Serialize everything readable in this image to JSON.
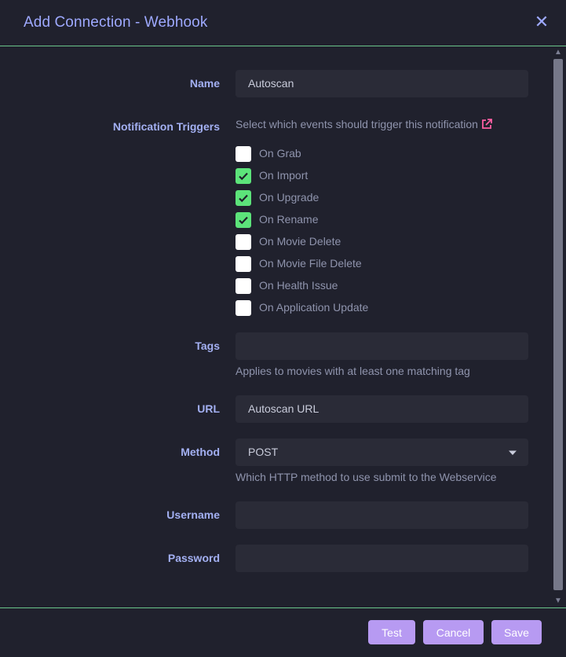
{
  "header": {
    "title": "Add Connection - Webhook",
    "close_glyph": "✕"
  },
  "fields": {
    "name": {
      "label": "Name",
      "value": "Autoscan"
    },
    "triggers": {
      "label": "Notification Triggers",
      "help": "Select which events should trigger this notification",
      "items": [
        {
          "label": "On Grab",
          "checked": false
        },
        {
          "label": "On Import",
          "checked": true
        },
        {
          "label": "On Upgrade",
          "checked": true
        },
        {
          "label": "On Rename",
          "checked": true
        },
        {
          "label": "On Movie Delete",
          "checked": false
        },
        {
          "label": "On Movie File Delete",
          "checked": false
        },
        {
          "label": "On Health Issue",
          "checked": false
        },
        {
          "label": "On Application Update",
          "checked": false
        }
      ]
    },
    "tags": {
      "label": "Tags",
      "value": "",
      "help": "Applies to movies with at least one matching tag"
    },
    "url": {
      "label": "URL",
      "value": "Autoscan URL"
    },
    "method": {
      "label": "Method",
      "value": "POST",
      "help": "Which HTTP method to use submit to the Webservice"
    },
    "username": {
      "label": "Username",
      "value": ""
    },
    "password": {
      "label": "Password",
      "value": ""
    }
  },
  "footer": {
    "test_label": "Test",
    "cancel_label": "Cancel",
    "save_label": "Save"
  },
  "colors": {
    "accent": "#9ea9ff",
    "checkbox_checked": "#5ce37a",
    "button": "#b79af2",
    "divider": "#6ac58a",
    "link_icon": "#ff5fa2"
  },
  "icons": {
    "close": "close-icon",
    "external": "external-link-icon",
    "dropdown": "caret-down-icon",
    "check": "check-icon"
  }
}
